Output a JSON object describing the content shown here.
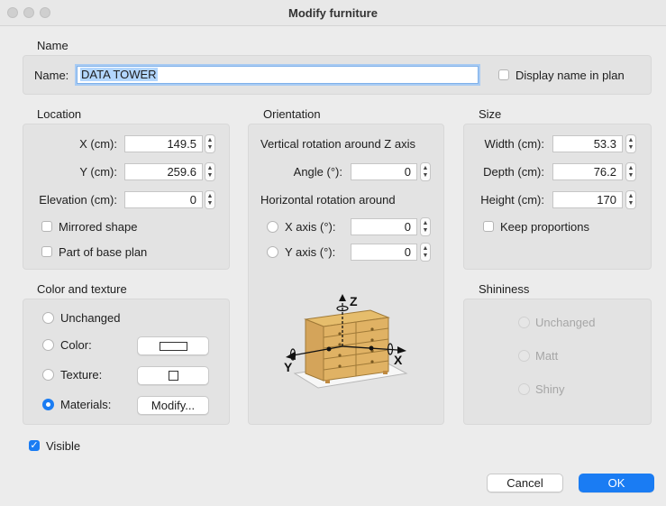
{
  "window": {
    "title": "Modify furniture"
  },
  "name_section": {
    "title": "Name",
    "label": "Name:",
    "value": "DATA TOWER",
    "display_name_label": "Display name in plan",
    "display_name_checked": false
  },
  "location": {
    "title": "Location",
    "x_label": "X (cm):",
    "x_value": "149.5",
    "y_label": "Y (cm):",
    "y_value": "259.6",
    "elevation_label": "Elevation (cm):",
    "elevation_value": "0",
    "mirrored_label": "Mirrored shape",
    "mirrored_checked": false,
    "base_plan_label": "Part of base plan",
    "base_plan_checked": false
  },
  "orientation": {
    "title": "Orientation",
    "vertical_label": "Vertical rotation around Z axis",
    "angle_label": "Angle (°):",
    "angle_value": "0",
    "horizontal_label": "Horizontal rotation around",
    "x_axis_label": "X axis (°):",
    "x_axis_value": "0",
    "y_axis_label": "Y axis (°):",
    "y_axis_value": "0",
    "diagram_z": "Z",
    "diagram_x": "X",
    "diagram_y": "Y"
  },
  "size": {
    "title": "Size",
    "width_label": "Width (cm):",
    "width_value": "53.3",
    "depth_label": "Depth (cm):",
    "depth_value": "76.2",
    "height_label": "Height (cm):",
    "height_value": "170",
    "keep_proportions_label": "Keep proportions",
    "keep_proportions_checked": false
  },
  "color_texture": {
    "title": "Color and texture",
    "unchanged_label": "Unchanged",
    "color_label": "Color:",
    "texture_label": "Texture:",
    "materials_label": "Materials:",
    "modify_button": "Modify...",
    "selected": "Materials"
  },
  "shininess": {
    "title": "Shininess",
    "unchanged_label": "Unchanged",
    "matt_label": "Matt",
    "shiny_label": "Shiny"
  },
  "visible": {
    "label": "Visible",
    "checked": true
  },
  "buttons": {
    "cancel": "Cancel",
    "ok": "OK"
  },
  "colors": {
    "accent": "#1a7cf3",
    "panel": "#e3e3e3",
    "background": "#ececec"
  }
}
